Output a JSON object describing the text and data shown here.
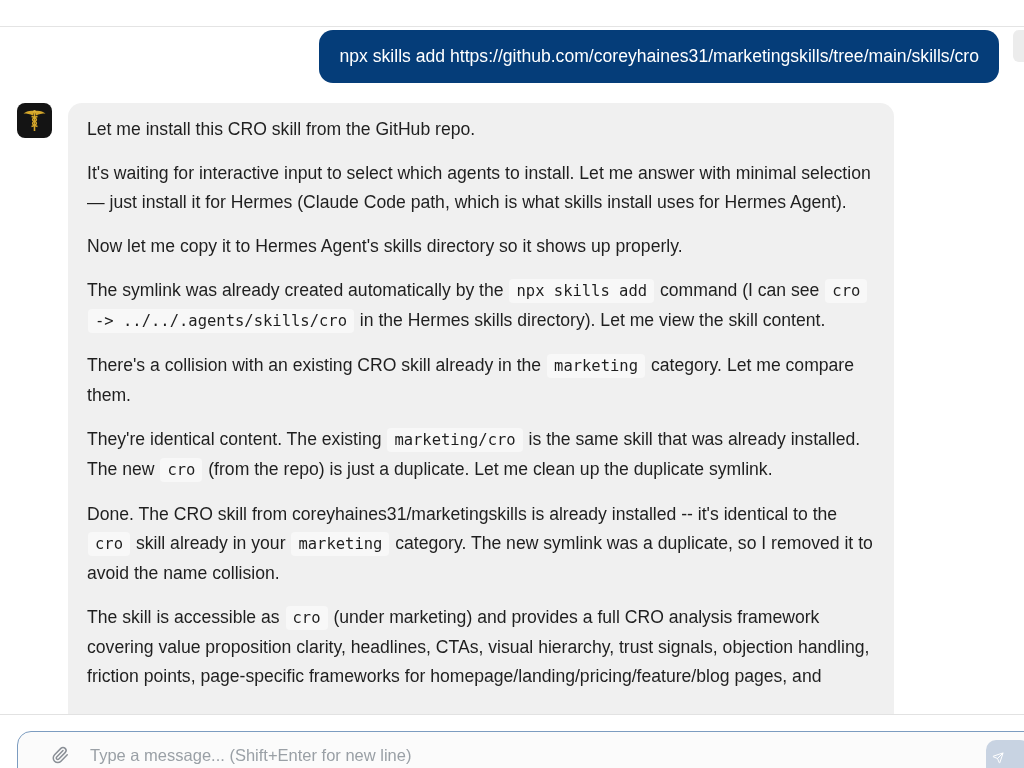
{
  "conversation": [
    {
      "kind": "user",
      "text": "npx skills add https://github.com/coreyhaines31/marketingskills/tree/main/skills/cro"
    },
    {
      "kind": "assistant",
      "paragraphs": [
        {
          "segments": [
            {
              "kind": "text",
              "text": "Let me install this CRO skill from the GitHub repo."
            }
          ]
        },
        {
          "segments": [
            {
              "kind": "text",
              "text": "It's waiting for interactive input to select which agents to install. Let me answer with minimal selection — just install it for Hermes (Claude Code path, which is what skills install uses for Hermes Agent)."
            }
          ]
        },
        {
          "segments": [
            {
              "kind": "text",
              "text": "Now let me copy it to Hermes Agent's skills directory so it shows up properly."
            }
          ]
        },
        {
          "segments": [
            {
              "kind": "text",
              "text": "The symlink was already created automatically by the "
            },
            {
              "kind": "code",
              "text": "npx skills add"
            },
            {
              "kind": "text",
              "text": " command (I can see "
            },
            {
              "kind": "code",
              "text": "cro -> ../../.agents/skills/cro"
            },
            {
              "kind": "text",
              "text": " in the Hermes skills directory). Let me view the skill content."
            }
          ]
        },
        {
          "segments": [
            {
              "kind": "text",
              "text": "There's a collision with an existing CRO skill already in the "
            },
            {
              "kind": "code",
              "text": "marketing"
            },
            {
              "kind": "text",
              "text": " category. Let me compare them."
            }
          ]
        },
        {
          "segments": [
            {
              "kind": "text",
              "text": "They're identical content. The existing "
            },
            {
              "kind": "code",
              "text": "marketing/cro"
            },
            {
              "kind": "text",
              "text": " is the same skill that was already installed. The new "
            },
            {
              "kind": "code",
              "text": "cro"
            },
            {
              "kind": "text",
              "text": " (from the repo) is just a duplicate. Let me clean up the duplicate symlink."
            }
          ]
        },
        {
          "segments": [
            {
              "kind": "text",
              "text": "Done. The CRO skill from coreyhaines31/marketingskills is already installed -- it's identical to the "
            },
            {
              "kind": "code",
              "text": "cro"
            },
            {
              "kind": "text",
              "text": " skill already in your "
            },
            {
              "kind": "code",
              "text": "marketing"
            },
            {
              "kind": "text",
              "text": " category. The new symlink was a duplicate, so I removed it to avoid the name collision."
            }
          ]
        },
        {
          "segments": [
            {
              "kind": "text",
              "text": "The skill is accessible as "
            },
            {
              "kind": "code",
              "text": "cro"
            },
            {
              "kind": "text",
              "text": " (under marketing) and provides a full CRO analysis framework covering value proposition clarity, headlines, CTAs, visual hierarchy, trust signals, objection handling, friction points, page-specific frameworks for homepage/landing/pricing/feature/blog pages, and"
            }
          ]
        }
      ]
    }
  ],
  "composer": {
    "placeholder": "Type a message... (Shift+Enter for new line)"
  }
}
